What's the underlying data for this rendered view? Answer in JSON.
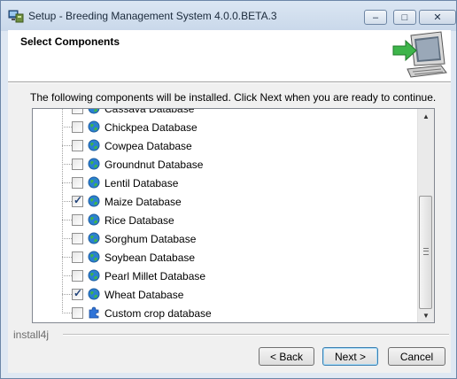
{
  "window": {
    "title": "Setup - Breeding Management System 4.0.0.BETA.3",
    "controls": {
      "minimize": "–",
      "maximize": "□",
      "close": "✕"
    }
  },
  "header": {
    "title": "Select Components"
  },
  "description": "The following components will be installed. Click Next when you are ready to continue.",
  "components": [
    {
      "label": "Cassava Database",
      "checked": false,
      "icon": "globe-icon"
    },
    {
      "label": "Chickpea Database",
      "checked": false,
      "icon": "globe-icon"
    },
    {
      "label": "Cowpea Database",
      "checked": false,
      "icon": "globe-icon"
    },
    {
      "label": "Groundnut Database",
      "checked": false,
      "icon": "globe-icon"
    },
    {
      "label": "Lentil Database",
      "checked": false,
      "icon": "globe-icon"
    },
    {
      "label": "Maize Database",
      "checked": true,
      "icon": "globe-icon"
    },
    {
      "label": "Rice Database",
      "checked": false,
      "icon": "globe-icon"
    },
    {
      "label": "Sorghum Database",
      "checked": false,
      "icon": "globe-icon"
    },
    {
      "label": "Soybean Database",
      "checked": false,
      "icon": "globe-icon"
    },
    {
      "label": "Pearl Millet Database",
      "checked": false,
      "icon": "globe-icon"
    },
    {
      "label": "Wheat Database",
      "checked": true,
      "icon": "globe-icon"
    },
    {
      "label": "Custom crop database",
      "checked": false,
      "icon": "puzzle-icon"
    }
  ],
  "scrollbar": {
    "up": "▲",
    "down": "▼"
  },
  "brand": "install4j",
  "buttons": {
    "back": "< Back",
    "next": "Next >",
    "cancel": "Cancel"
  },
  "colors": {
    "accent_green": "#3db54a",
    "globe_blue": "#2a7fd4",
    "puzzle_blue": "#2e73d8"
  }
}
